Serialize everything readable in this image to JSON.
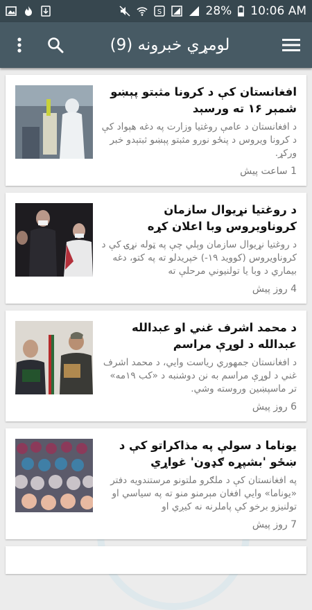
{
  "status": {
    "battery": "28%",
    "time": "10:06 AM"
  },
  "header": {
    "title": "لومړي خبرونه (9)"
  },
  "articles": [
    {
      "title": "افغانستان کې د کرونا مثبتو پېښو شمېر ۱۶ ته ورسېد",
      "summary": "د افغانستان د عامې روغتیا وزارت په دغه هېواد کې د کرونا ویروس د پنځو نورو مثبتو پېښو ثبتېدو خبر ورکړ.",
      "time": "1 ساعت پیش"
    },
    {
      "title": "د روغتیا نړیوال سازمان کروناویروس وبا اعلان کړه",
      "summary": "د روغتیا نړیوال سازمان وېلي چې په ټوله نړۍ کې د کروناویروس (کووید ۱۹-) خپریدلو ته په کتو، دغه بیماري د وبا یا تولنیوني مرحلې ته",
      "time": "4 روز پیش"
    },
    {
      "title": "د محمد اشرف غني او عبدالله عبدالله د لوړې مراسم",
      "summary": "د افغانستان جمهوري ریاست وایي، د محمد اشرف غني د لوړې مراسم به نن دوشنبه د «کب ۱۹مه» تر ماسپښین وروسته وشي.",
      "time": "6 روز پیش"
    },
    {
      "title": "یوناما د سولې په مذاکراتو کې د ښځو 'بشپړه ګډون' غواړي",
      "summary": "په افغانستان کې د ملګرو ملتونو مرستندویه دفتر «یوناما» وایي افغان مېرمنو منو ته په سیاسي او تولنیزو برخو کې پاملرنه نه کیږي او",
      "time": "7 روز پیش"
    }
  ],
  "colors": {
    "statusbar": "#37474f",
    "appbar": "#475a64",
    "background": "#ececec"
  }
}
